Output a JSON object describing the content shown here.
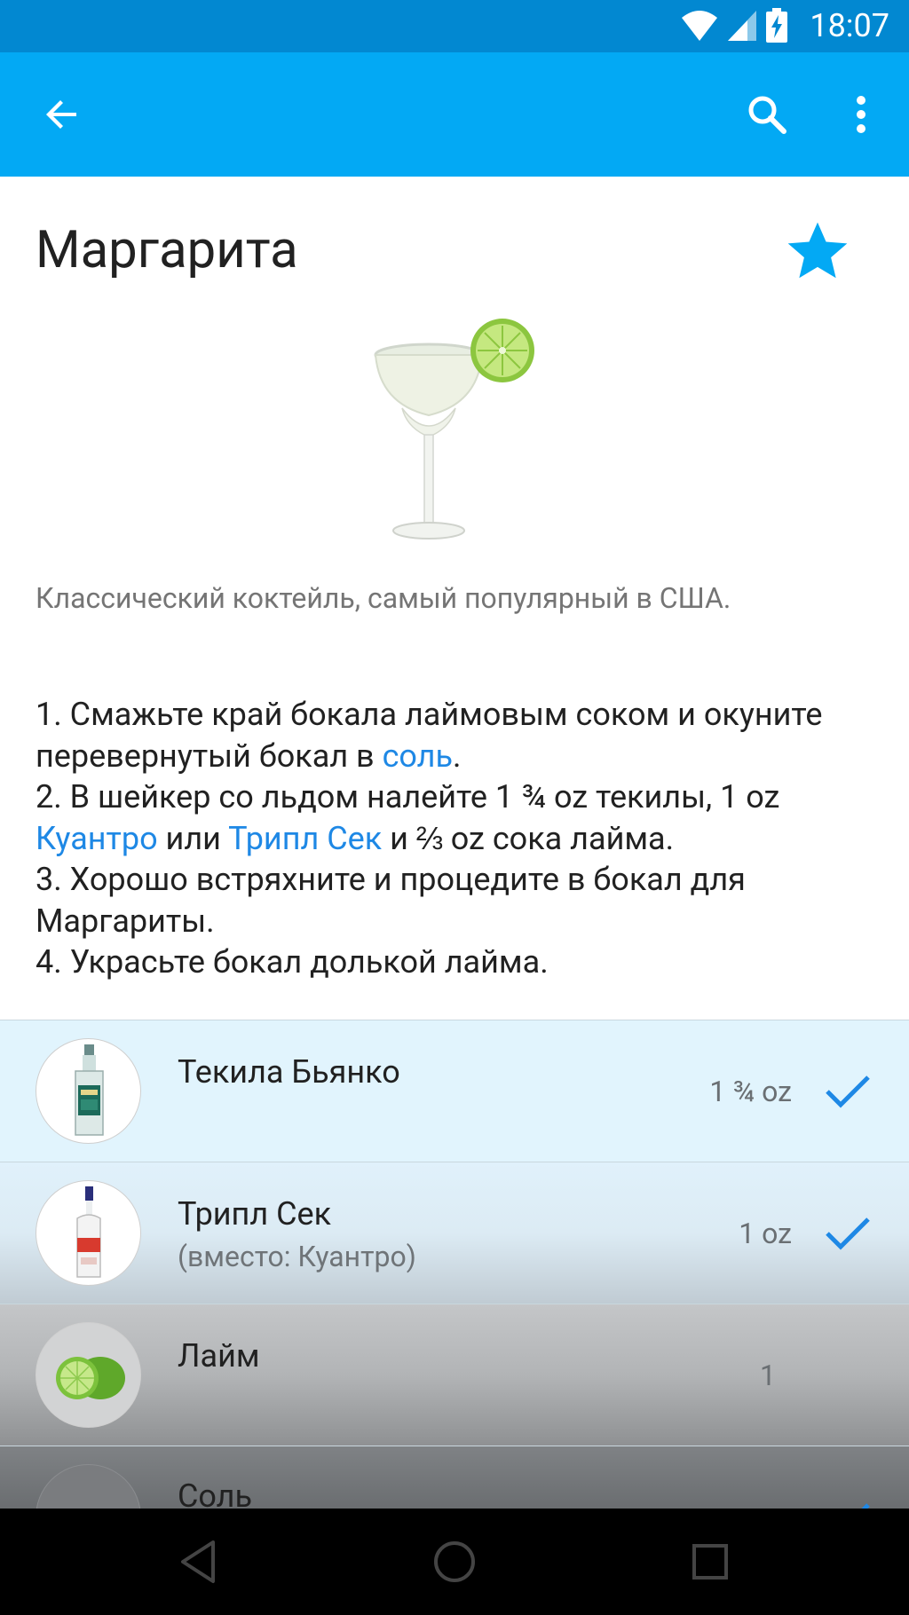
{
  "status_bar": {
    "time": "18:07"
  },
  "app_bar": {
    "back_icon": "arrow-left-icon",
    "search_icon": "search-icon",
    "more_icon": "more-vert-icon"
  },
  "drink": {
    "title": "Маргарита",
    "favorite": true,
    "description": "Классический коктейль, самый популярный в США."
  },
  "instructions": {
    "line1_a": "1. Смажьте край бокала лаймовым соком и окуните перевернутый бокал в ",
    "line1_link": "соль",
    "line1_b": ".",
    "line2_a": "2. В шейкер со льдом налейте 1 ¾ oz текилы, 1 oz ",
    "line2_link1": "Куантро",
    "line2_mid": " или ",
    "line2_link2": "Трипл Сек",
    "line2_b": " и ⅔ oz сока лайма.",
    "line3": "3. Хорошо встряхните и процедите в бокал для Маргариты.",
    "line4": "4. Украсьте бокал долькой лайма."
  },
  "ingredients": [
    {
      "name": "Текила Бьянко",
      "sub": "",
      "amount": "1 ¾ oz",
      "checked": true
    },
    {
      "name": "Трипл Сек",
      "sub": "(вместо: Куантро)",
      "amount": "1 oz",
      "checked": true
    },
    {
      "name": "Лайм",
      "sub": "",
      "amount": "1",
      "checked": false
    },
    {
      "name": "Соль",
      "sub": "",
      "amount": "",
      "checked": true
    }
  ],
  "colors": {
    "accent": "#03a9f4",
    "link": "#1e88e5",
    "status": "#0288d1"
  }
}
